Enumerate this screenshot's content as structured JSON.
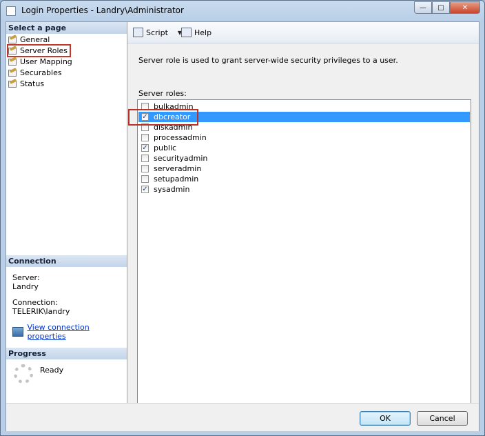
{
  "window": {
    "title": "Login Properties - Landry\\Administrator"
  },
  "left": {
    "select_header": "Select a page",
    "pages": [
      {
        "label": "General"
      },
      {
        "label": "Server Roles"
      },
      {
        "label": "User Mapping"
      },
      {
        "label": "Securables"
      },
      {
        "label": "Status"
      }
    ],
    "connection_header": "Connection",
    "server_label": "Server:",
    "server_value": "Landry",
    "connection_label": "Connection:",
    "connection_value": "TELERIK\\landry",
    "view_link": "View connection properties",
    "progress_header": "Progress",
    "progress_status": "Ready"
  },
  "toolbar": {
    "script_label": "Script",
    "help_label": "Help"
  },
  "main": {
    "description": "Server role is used to grant server-wide security privileges to a user.",
    "roles_label": "Server roles:",
    "roles": [
      {
        "name": "bulkadmin",
        "checked": false
      },
      {
        "name": "dbcreator",
        "checked": true
      },
      {
        "name": "diskadmin",
        "checked": false
      },
      {
        "name": "processadmin",
        "checked": false
      },
      {
        "name": "public",
        "checked": true
      },
      {
        "name": "securityadmin",
        "checked": false
      },
      {
        "name": "serveradmin",
        "checked": false
      },
      {
        "name": "setupadmin",
        "checked": false
      },
      {
        "name": "sysadmin",
        "checked": true
      }
    ]
  },
  "footer": {
    "ok_label": "OK",
    "cancel_label": "Cancel"
  }
}
